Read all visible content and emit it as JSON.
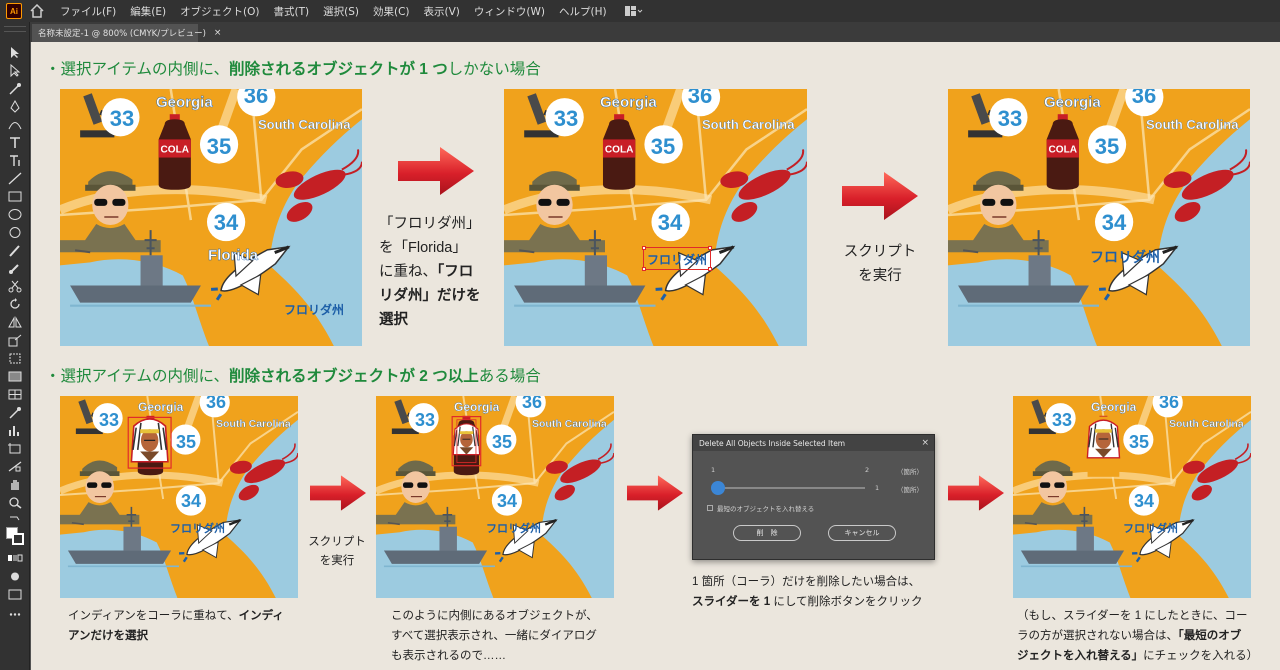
{
  "app": {
    "logo": "Ai",
    "menu": [
      "ファイル(F)",
      "編集(E)",
      "オブジェクト(O)",
      "書式(T)",
      "選択(S)",
      "効果(C)",
      "表示(V)",
      "ウィンドウ(W)",
      "ヘルプ(H)"
    ],
    "document_tab": "名称未設定-1 @ 800% (CMYK/プレビュー)",
    "tab_close": "×"
  },
  "section1": {
    "heading_pre": "・選択アイテムの内側に、",
    "heading_bold": "削除されるオブジェクトが 1 つ",
    "heading_post": "しかない場合",
    "caption1_lines": [
      "「フロリダ州」",
      "を「Florida」",
      "に重ね、"
    ],
    "caption1_bold_tail": "「フロ",
    "caption1_bold_lines": [
      "リダ州」",
      "選択"
    ],
    "caption1_tail2": "だけを",
    "caption2_lines": [
      "スクリプト",
      "を実行"
    ]
  },
  "section2": {
    "heading_pre": "・選択アイテムの内側に、",
    "heading_bold": "削除されるオブジェクトが 2 つ以上",
    "heading_post": "ある場合",
    "caption_arrow": [
      "スクリプト",
      "を実行"
    ],
    "note1_line1_pre": "インディアンをコーラに重ねて、",
    "note1_line1_bold": "インディ",
    "note1_line2_bold": "アンだけを選択",
    "note2_lines": [
      "このように内側にあるオブジェクトが、",
      "すべて選択表示され、一緒にダイアログ",
      "も表示されるので……"
    ],
    "note3_line1": "1 箇所（コーラ）だけを削除したい場合は、",
    "note3_line2_bold": "スライダーを 1",
    "note3_line2_post": " にして削除ボタンをクリック",
    "note4_line1": "（もし、スライダーを 1 にしたときに、コー",
    "note4_line2_pre": "ラの方が選択されない場合は、",
    "note4_line2_bold": "「最短のオブ",
    "note4_line3_bold": "ジェクトを入れ替える」",
    "note4_line3_post": "にチェックを入れる）"
  },
  "map_labels": {
    "georgia": "Georgia",
    "south_carolina": "South Carolina",
    "florida_en": "Florida",
    "florida_jp": "フロリダ州",
    "cola": "COLA",
    "n33": "33",
    "n34": "34",
    "n35": "35",
    "n36": "36"
  },
  "dialog": {
    "title": "Delete All Objects Inside Selected Item",
    "close": "×",
    "scale_min": "1",
    "scale_max": "2",
    "unit_top": "（箇所）",
    "value": "1",
    "unit_bottom": "（箇所）",
    "checkbox_label": "最短のオブジェクトを入れ替える",
    "delete_button": "削　除",
    "cancel_button": "キャンセル"
  },
  "colors": {
    "heading_green": "#1f8a3c",
    "arrow_red": "#d6202a",
    "map_orange": "#f0a21c",
    "sea_blue": "#9ccbe0",
    "number_blue": "#2e8fcf",
    "label_blue": "#1d5fa8"
  }
}
